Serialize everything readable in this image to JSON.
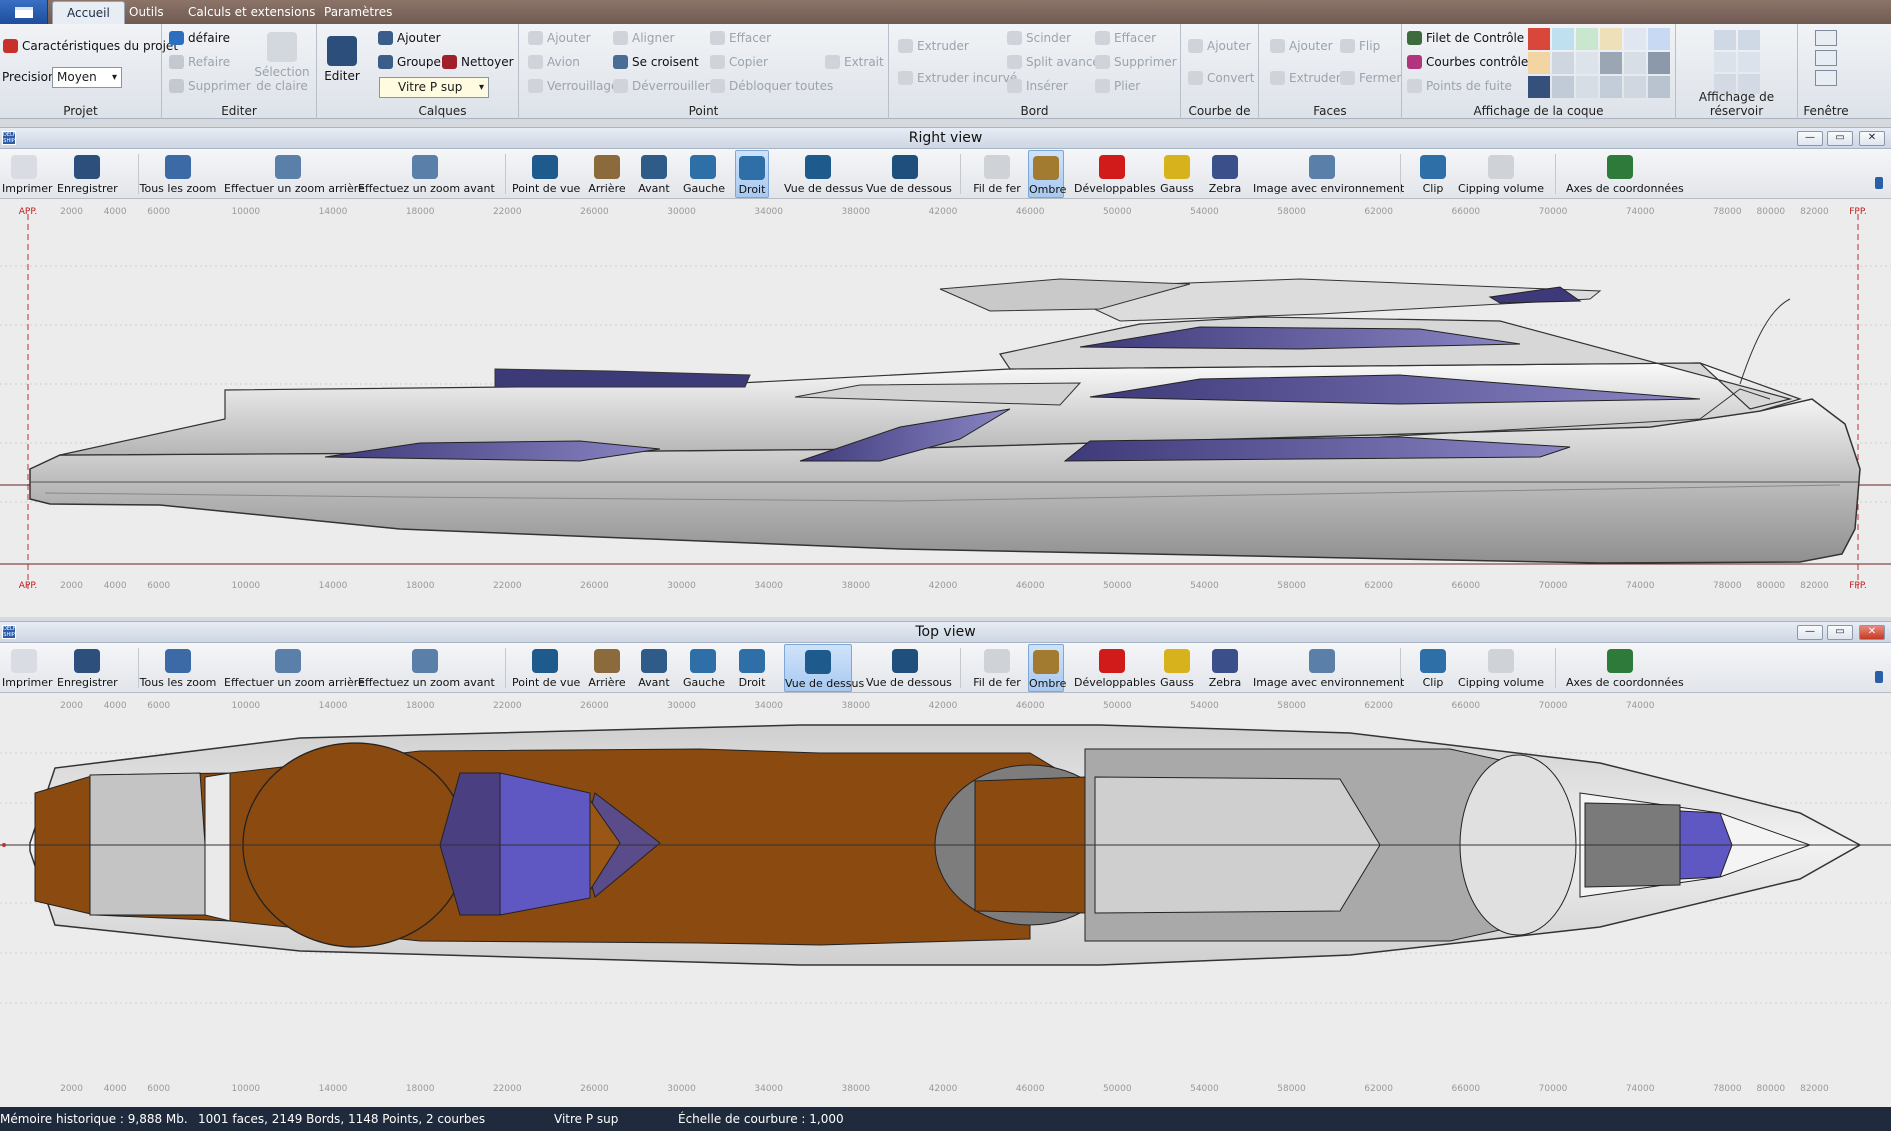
{
  "tabs": [
    {
      "label": "Accueil",
      "active": true
    },
    {
      "label": "Outils"
    },
    {
      "label": "Calculs et extensions"
    },
    {
      "label": "Paramètres"
    }
  ],
  "ribbon": {
    "projet": {
      "title": "Projet",
      "characteristics": "Caractéristiques du projet",
      "precision_label": "Precision",
      "precision_value": "Moyen"
    },
    "editer": {
      "title": "Editer",
      "undo": "défaire",
      "redo": "Refaire",
      "delete": "Supprimer",
      "selection": "Sélection de claire"
    },
    "editer_big": {
      "label": "Editer"
    },
    "calques": {
      "title": "Calques",
      "add": "Ajouter",
      "group": "Groupe",
      "clean": "Nettoyer",
      "current": "Vitre P sup"
    },
    "point": {
      "title": "Point",
      "add": "Ajouter",
      "plane": "Avion",
      "lock": "Verrouillage",
      "align": "Aligner",
      "intersect": "Se croisent",
      "unlock": "Déverrouiller",
      "erase": "Effacer",
      "copy": "Copier",
      "unlock_all": "Débloquer toutes",
      "extract": "Extrait"
    },
    "bord": {
      "title": "Bord",
      "extrude": "Extruder",
      "extrude_curve": "Extruder incurvé",
      "split": "Scinder",
      "split_adv": "Split avancé",
      "insert": "Insérer",
      "erase": "Effacer",
      "delete": "Supprimer",
      "fold": "Plier"
    },
    "courbe": {
      "title": "Courbe de",
      "add": "Ajouter",
      "convert": "Convert"
    },
    "faces": {
      "title": "Faces",
      "add": "Ajouter",
      "extrude": "Extruder",
      "flip": "Flip",
      "close": "Fermer"
    },
    "hull": {
      "title": "Affichage de la coque",
      "control_net": "Filet de Contrôle",
      "control_curves": "Courbes  contrôle",
      "vanishing": "Points de fuite"
    },
    "tank": {
      "title": "Affichage de réservoir"
    },
    "window": {
      "title": "Fenêtre"
    }
  },
  "toolbar": [
    "Imprimer",
    "Enregistrer",
    "Tous les zoom",
    "Effectuer un zoom arrière",
    "Effectuez un zoom avant",
    "Point de vue",
    "Arrière",
    "Avant",
    "Gauche",
    "Droit",
    "Vue de dessus",
    "Vue de dessous",
    "Fil de fer",
    "Ombre",
    "Développables",
    "Gauss",
    "Zebra",
    "Image avec environnement",
    "Clip",
    "Cipping volume",
    "Axes de coordonnées"
  ],
  "views": {
    "right": {
      "title": "Right view",
      "active_view": "Droit",
      "shading": "Ombre"
    },
    "top": {
      "title": "Top view",
      "active_view": "Vue de dessus",
      "shading": "Ombre"
    }
  },
  "ruler": {
    "start_label": "APP.",
    "end_label": "FPP.",
    "ticks": [
      "2000",
      "4000",
      "6000",
      "10000",
      "14000",
      "18000",
      "22000",
      "26000",
      "30000",
      "34000",
      "38000",
      "42000",
      "46000",
      "50000",
      "54000",
      "58000",
      "62000",
      "66000",
      "70000",
      "74000",
      "78000",
      "80000",
      "82000"
    ],
    "ticks_top": [
      "2000",
      "4000",
      "6000",
      "10000",
      "14000",
      "18000",
      "22000",
      "26000",
      "30000",
      "34000",
      "38000",
      "42000",
      "46000",
      "50000",
      "54000",
      "58000",
      "62000",
      "66000",
      "70000",
      "74000"
    ],
    "ticks_top_bottom": [
      "2000",
      "4000",
      "6000",
      "10000",
      "14000",
      "18000",
      "22000",
      "26000",
      "30000",
      "34000",
      "38000",
      "42000",
      "46000",
      "50000",
      "54000",
      "58000",
      "62000",
      "66000",
      "70000",
      "74000",
      "78000",
      "80000",
      "82000"
    ]
  },
  "colors": {
    "deck": "#8b4a0f",
    "glass": "#5f57c2",
    "hull": "#c9c9c9",
    "ribbon_bg": "#e4e8ee",
    "status_bg": "#1f2a3c"
  },
  "status": {
    "memory": "Mémoire historique : 9,888 Mb.",
    "counts": "1001 faces, 2149 Bords, 1148 Points, 2 courbes",
    "layer": "Vitre P sup",
    "curvature": "Échelle de courbure : 1,000"
  }
}
